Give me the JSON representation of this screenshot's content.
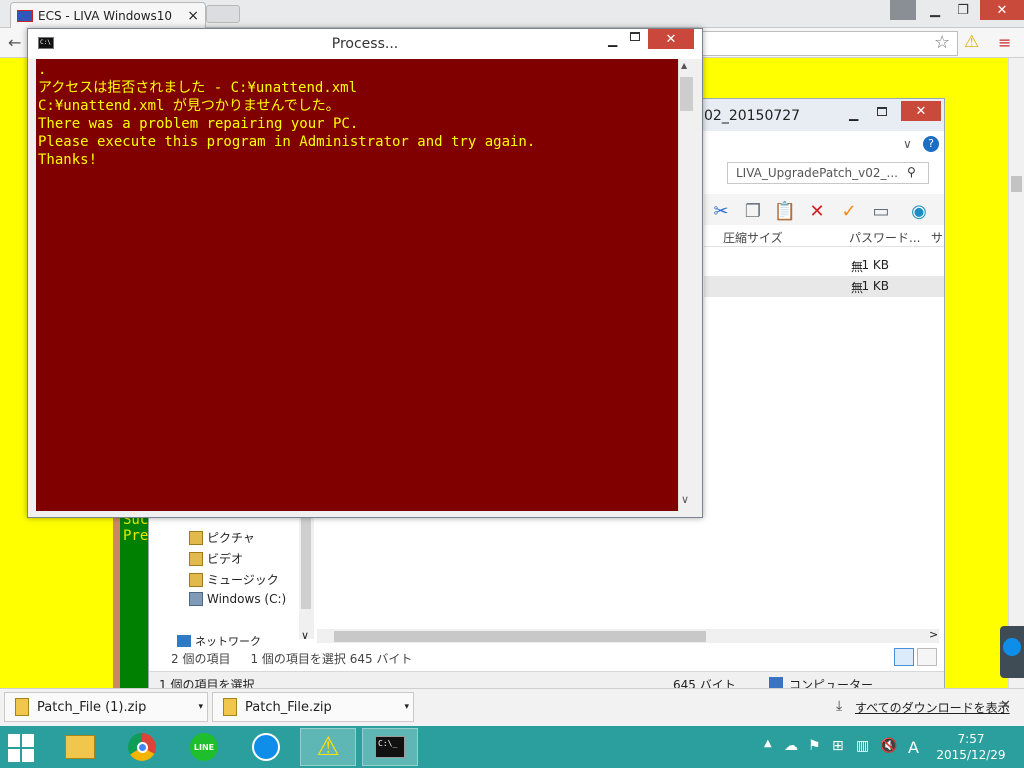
{
  "browser": {
    "tab_title": "ECS - LIVA Windows10",
    "tab_close": "×",
    "window_min": "▁",
    "window_max": "❐",
    "window_close": "✕"
  },
  "page_text": {
    "line1": "Suc",
    "line2": "Pre"
  },
  "explorer": {
    "title": "02_20150727",
    "search_placeholder": "LIVA_UpgradePatch_v02_...",
    "toolbar_icons": [
      "scissors-icon",
      "copy-icon",
      "paste-icon",
      "delete-icon",
      "check-icon",
      "rename-icon",
      "shell-icon"
    ],
    "columns": [
      "圧縮サイズ",
      "パスワード...",
      "サ"
    ],
    "rows": [
      {
        "size": "1 KB",
        "password": "無",
        "selected": false
      },
      {
        "size": "1 KB",
        "password": "無",
        "selected": true
      }
    ],
    "nav_items": [
      "ピクチャ",
      "ビデオ",
      "ミュージック",
      "Windows (C:)"
    ],
    "nav_network": "ネットワーク",
    "status_count": "2 個の項目",
    "status_selected": "1 個の項目を選択  645 バイト",
    "status2_left": "1 個の項目を選択",
    "status2_size": "645 バイト",
    "status2_location": "コンピューター"
  },
  "process_window": {
    "title": "Process...",
    "console_lines": [
      ".",
      "アクセスは拒否されました - C:¥unattend.xml",
      "C:¥unattend.xml が見つかりませんでした。",
      "There was a problem repairing your PC.",
      "Please execute this program in Administrator and try again.",
      "Thanks!"
    ],
    "scroll_up": "▲",
    "scroll_down": "∨"
  },
  "downloads": {
    "items": [
      "Patch_File (1).zip",
      "Patch_File.zip"
    ],
    "show_all": "すべてのダウンロードを表示",
    "close": "✕"
  },
  "taskbar": {
    "time": "7:57",
    "date": "2015/12/29",
    "ime": "A",
    "apps": [
      "file-explorer-icon",
      "chrome-icon",
      "line-icon",
      "teamviewer-icon",
      "warning-app-icon",
      "cmd-icon"
    ]
  },
  "colors": {
    "page_bg": "#ffff00",
    "console_bg": "#800000",
    "console_fg": "#ffff00",
    "taskbar": "#2a9f9d",
    "close_btn": "#c94a3b"
  }
}
